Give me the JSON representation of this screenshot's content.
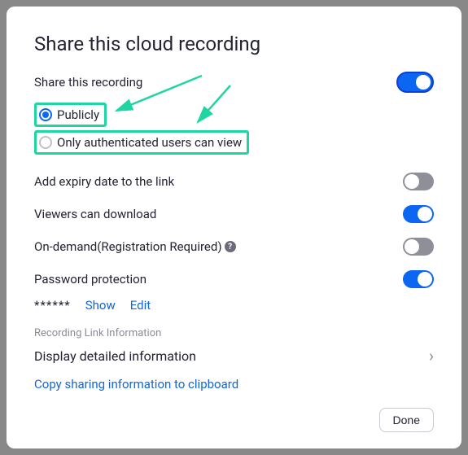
{
  "title": "Share this cloud recording",
  "share": {
    "label": "Share this recording",
    "option_public": "Publicly",
    "option_auth": "Only authenticated users can view"
  },
  "settings": {
    "expiry": "Add expiry date to the link",
    "download": "Viewers can download",
    "ondemand": "On-demand(Registration Required)",
    "password": "Password protection"
  },
  "password": {
    "mask": "******",
    "show": "Show",
    "edit": "Edit"
  },
  "linkinfo": {
    "section": "Recording Link Information",
    "detail": "Display detailed information",
    "copy": "Copy sharing information to clipboard"
  },
  "buttons": {
    "done": "Done"
  }
}
